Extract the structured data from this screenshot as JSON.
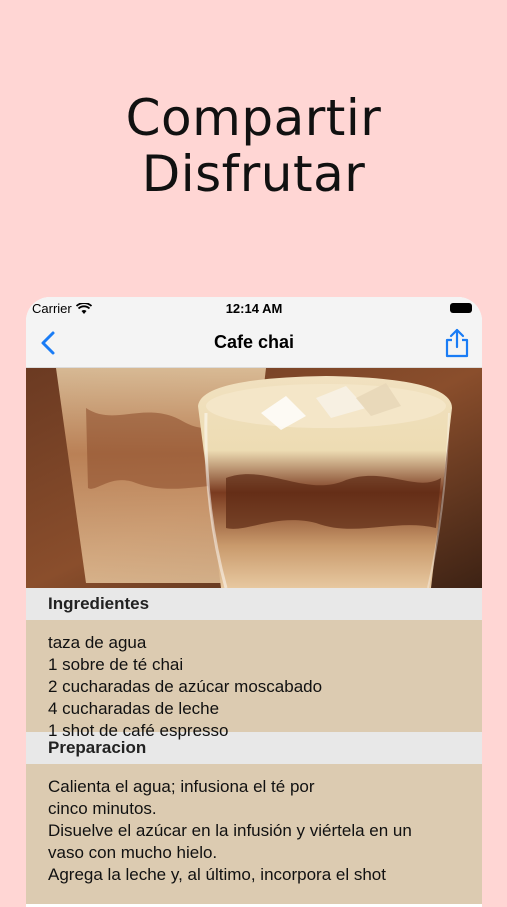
{
  "headline": {
    "line1": "Compartir",
    "line2": "Disfrutar"
  },
  "status_bar": {
    "carrier": "Carrier",
    "time": "12:14 AM"
  },
  "nav": {
    "title": "Cafe chai"
  },
  "ingredients": {
    "header": "Ingredientes",
    "items": [
      "taza de agua",
      "1 sobre de té chai",
      "2 cucharadas de azúcar moscabado",
      "4 cucharadas de leche",
      "1 shot de café espresso"
    ]
  },
  "preparation": {
    "header": "Preparacion",
    "lines": [
      "Calienta el agua; infusiona el té por",
      "cinco minutos.",
      "Disuelve el azúcar en la infusión y viértela en un",
      "vaso con mucho hielo.",
      "Agrega la leche y, al último, incorpora el shot"
    ]
  },
  "colors": {
    "background": "#ffd6d4",
    "accent": "#1a7cf5",
    "section_body": "#dccbb1",
    "section_header": "#e8e8e8"
  }
}
